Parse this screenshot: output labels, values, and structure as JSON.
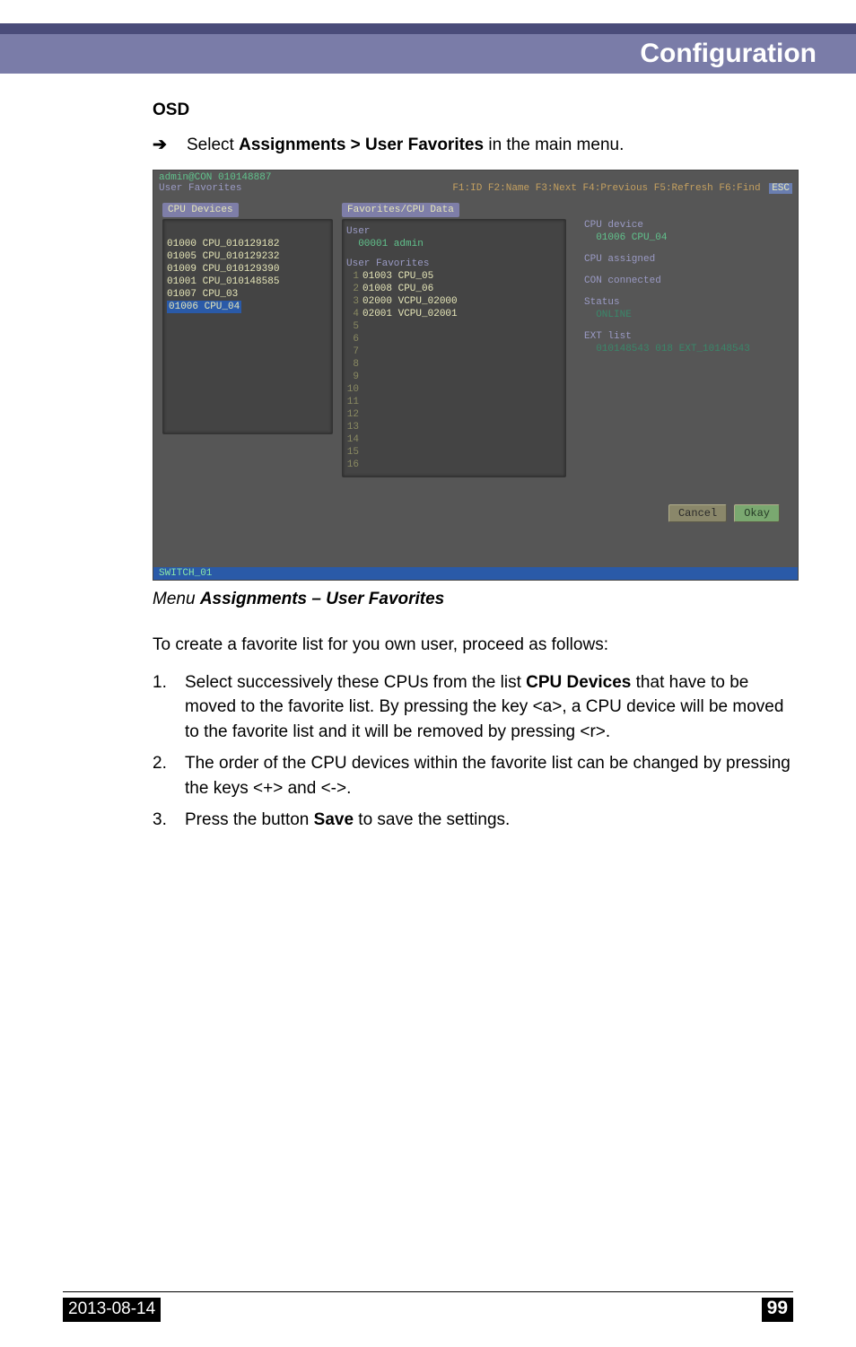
{
  "header": {
    "title": "Configuration"
  },
  "section": {
    "osd_heading": "OSD",
    "select_line_prefix": "Select ",
    "select_line_bold": "Assignments > User Favorites",
    "select_line_suffix": " in the main menu."
  },
  "osd": {
    "top_admin": "admin@CON 010148887",
    "breadcrumb": "User Favorites",
    "fkeys": "F1:ID  F2:Name  F3:Next  F4:Previous  F5:Refresh  F6:Find",
    "esc": "ESC",
    "left_title": "CPU Devices",
    "mid_title": "Favorites/CPU Data",
    "left_devices": [
      "01000 CPU_010129182",
      "01005 CPU_010129232",
      "01009 CPU_010129390",
      "01001 CPU_010148585",
      "01007 CPU_03"
    ],
    "left_selected": "01006 CPU_04",
    "mid_user_label": "User",
    "mid_user_value": "00001 admin",
    "mid_fav_label": "User Favorites",
    "mid_fav_items": [
      {
        "slot": "1",
        "val": "01003 CPU_05"
      },
      {
        "slot": "2",
        "val": "01008 CPU_06"
      },
      {
        "slot": "3",
        "val": "02000 VCPU_02000"
      },
      {
        "slot": "4",
        "val": "02001 VCPU_02001"
      },
      {
        "slot": "5",
        "val": ""
      },
      {
        "slot": "6",
        "val": ""
      },
      {
        "slot": "7",
        "val": ""
      },
      {
        "slot": "8",
        "val": ""
      },
      {
        "slot": "9",
        "val": ""
      },
      {
        "slot": "10",
        "val": ""
      },
      {
        "slot": "11",
        "val": ""
      },
      {
        "slot": "12",
        "val": ""
      },
      {
        "slot": "13",
        "val": ""
      },
      {
        "slot": "14",
        "val": ""
      },
      {
        "slot": "15",
        "val": ""
      },
      {
        "slot": "16",
        "val": ""
      }
    ],
    "right": {
      "cpu_device_label": "CPU device",
      "cpu_device_value": "01006 CPU_04",
      "cpu_assigned_label": "CPU assigned",
      "con_connected_label": "CON connected",
      "status_label": "Status",
      "status_value": "ONLINE",
      "ext_list_label": "EXT list",
      "ext_list_value": "010148543 018 EXT_10148543"
    },
    "btn_cancel": "Cancel",
    "btn_ok": "Okay",
    "footer_switch": "SWITCH_01"
  },
  "caption": {
    "prefix": "Menu ",
    "bold": "Assignments – User Favorites"
  },
  "body": {
    "intro": "To create a favorite list for you own user, proceed as follows:",
    "steps": [
      {
        "n": "1.",
        "html_parts": [
          "Select successively these CPUs from the list ",
          "CPU Devices",
          " that have to be moved to the favorite list. By pressing the key <a>, a CPU device will be moved to the favorite list and it will be removed by pressing <r>."
        ]
      },
      {
        "n": "2.",
        "text": "The order of the CPU devices within the favorite list can be changed by pressing the keys <+> and <->."
      },
      {
        "n": "3.",
        "html_parts": [
          "Press the button ",
          "Save",
          " to save the settings."
        ]
      }
    ]
  },
  "footer": {
    "date": "2013-08-14",
    "page": "99"
  }
}
